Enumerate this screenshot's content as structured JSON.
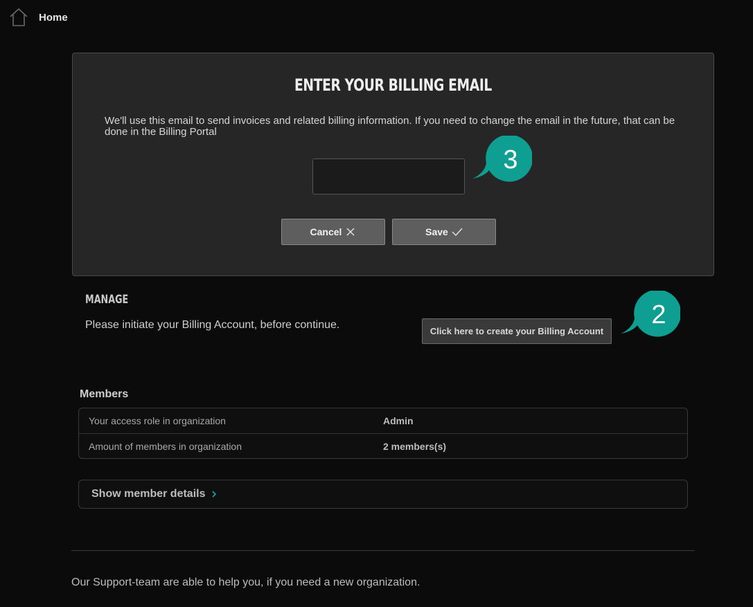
{
  "nav": {
    "home_label": "Home",
    "home_icon": "home-icon"
  },
  "dialog": {
    "title": "ENTER YOUR BILLING EMAIL",
    "description": "We'll use this email to send invoices and related billing information. If you need to change the email in the future, that can be done in the Billing Portal",
    "email_value": "",
    "cancel_label": "Cancel",
    "cancel_icon": "close-icon",
    "save_label": "Save",
    "save_icon": "check-icon"
  },
  "callouts": {
    "step_3": "3",
    "step_2": "2",
    "color": "#0f9e92"
  },
  "manage": {
    "title": "MANAGE",
    "text": "Please initiate your Billing Account, before continue.",
    "create_button_label": "Click here to create your Billing Account"
  },
  "members": {
    "title": "Members",
    "rows": [
      {
        "label": "Your access role in organization",
        "value": "Admin"
      },
      {
        "label": "Amount of members in organization",
        "value": "2 members(s)"
      }
    ],
    "details_label": "Show member details",
    "details_icon": "chevron-right-icon",
    "accent": "#1aa3a8"
  },
  "footer": {
    "support_text": "Our Support-team are able to help you, if you need a new organization."
  }
}
